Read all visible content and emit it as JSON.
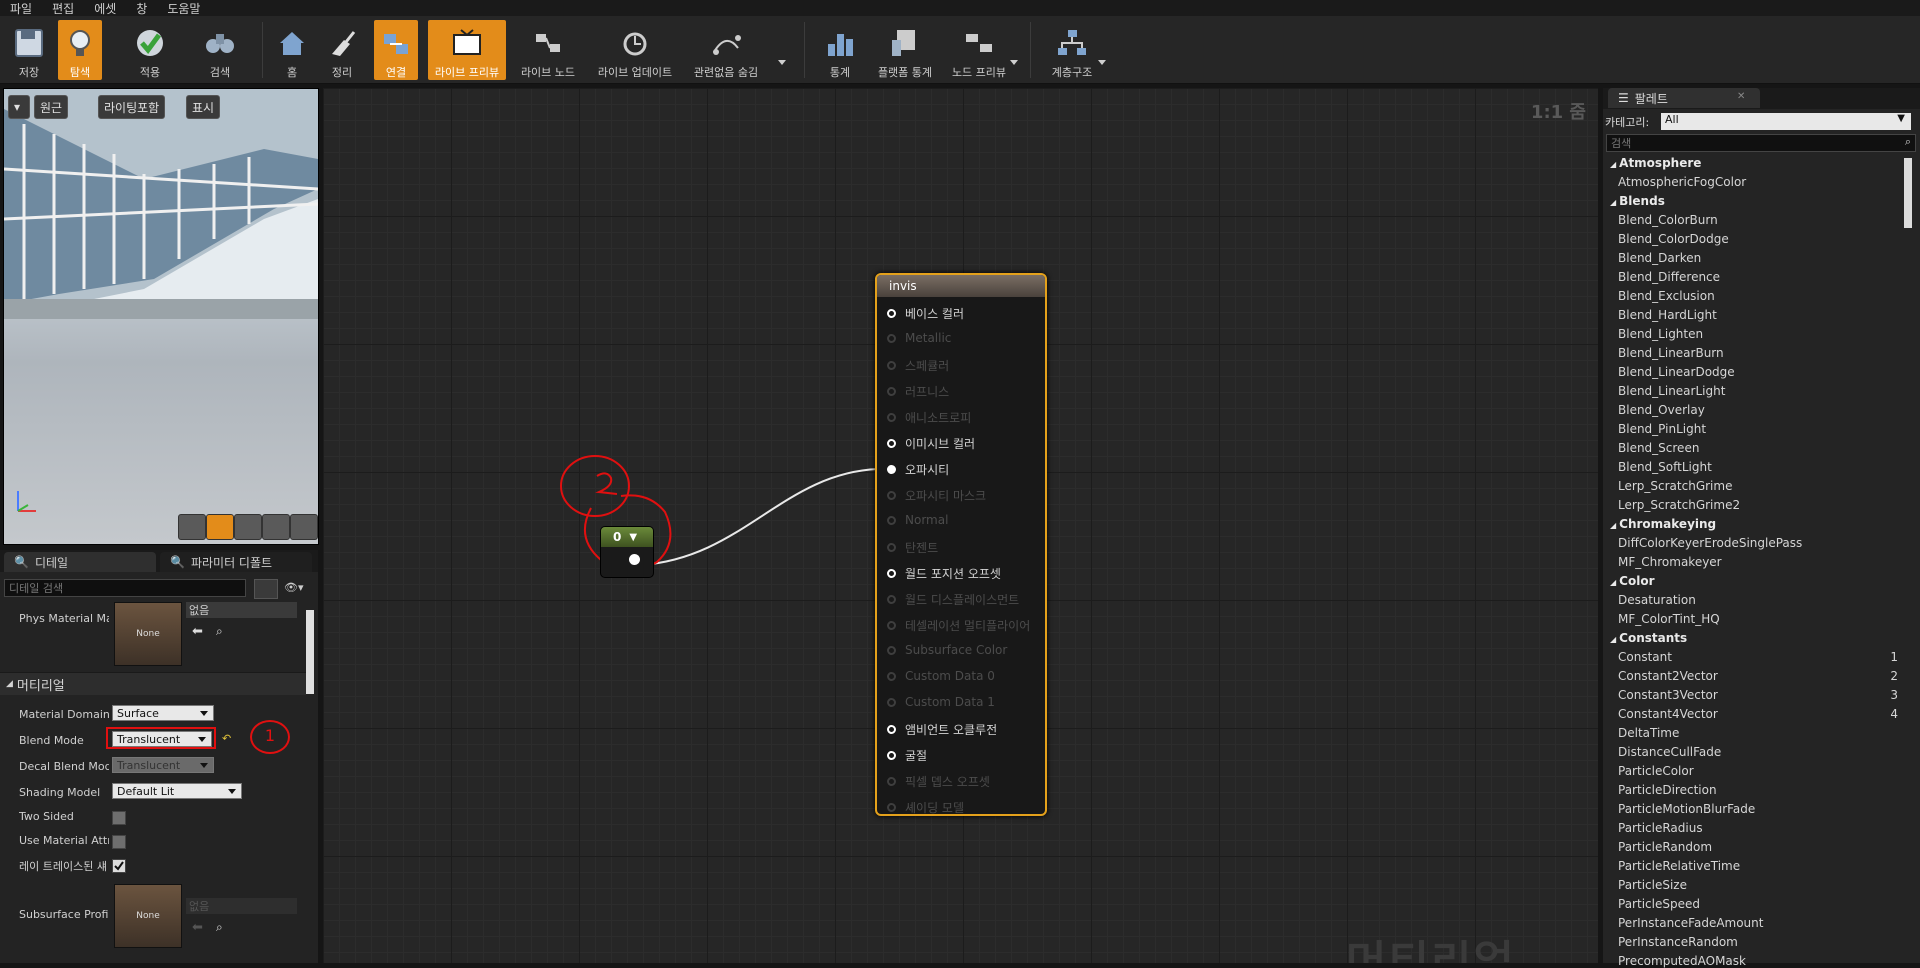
{
  "menu": [
    "파일",
    "편집",
    "에셋",
    "창",
    "도움말"
  ],
  "toolbar": {
    "save": "저장",
    "browse": "탐색",
    "apply": "적용",
    "search": "검색",
    "home": "홈",
    "cleanup": "정리",
    "connectors": "연결",
    "live_preview": "라이브 프리뷰",
    "live_nodes": "라이브 노드",
    "live_update": "라이브 업데이트",
    "hide_unrelated": "관련없음 숨김",
    "stats": "통계",
    "platform_stats": "플랫폼 통계",
    "node_preview": "노드 프리뷰",
    "hierarchy": "계층구조"
  },
  "viewport": {
    "perspective": "원근",
    "lit": "라이팅포함",
    "show": "표시"
  },
  "details": {
    "tab_details": "디테일",
    "tab_params": "파라미터 디폴트",
    "search_placeholder": "디테일 검색",
    "phys_material_label": "Phys Material Ma",
    "none": "None",
    "none_kr": "없음",
    "section_material": "머티리얼",
    "rows": [
      {
        "label": "Material Domain",
        "value": "Surface"
      },
      {
        "label": "Blend Mode",
        "value": "Translucent"
      },
      {
        "label": "Decal Blend Mode",
        "value": "Translucent"
      },
      {
        "label": "Shading Model",
        "value": "Default Lit"
      },
      {
        "label": "Two Sided"
      },
      {
        "label": "Use Material Attri"
      },
      {
        "label": "레이 트레이스된 섀"
      },
      {
        "label": "Subsurface Profil"
      }
    ],
    "annotation_1": "1"
  },
  "graph": {
    "zoom": "1:1 줌",
    "watermark": "머티리얼",
    "annotation_2": "2",
    "const_node_value": "0",
    "node_title": "invis",
    "pins": [
      {
        "label": "베이스 컬러",
        "active": true
      },
      {
        "label": "Metallic",
        "active": false
      },
      {
        "label": "스페큘러",
        "active": false
      },
      {
        "label": "러프니스",
        "active": false
      },
      {
        "label": "애니소트로피",
        "active": false
      },
      {
        "label": "이미시브 컬러",
        "active": true
      },
      {
        "label": "오파시티",
        "active": true
      },
      {
        "label": "오파시티 마스크",
        "active": false
      },
      {
        "label": "Normal",
        "active": false
      },
      {
        "label": "탄젠트",
        "active": false
      },
      {
        "label": "월드 포지션 오프셋",
        "active": true
      },
      {
        "label": "월드 디스플레이스먼트",
        "active": false
      },
      {
        "label": "테셀레이션 멀티플라이어",
        "active": false
      },
      {
        "label": "Subsurface Color",
        "active": false
      },
      {
        "label": "Custom Data 0",
        "active": false
      },
      {
        "label": "Custom Data 1",
        "active": false
      },
      {
        "label": "앰비언트 오클루전",
        "active": true
      },
      {
        "label": "굴절",
        "active": true
      },
      {
        "label": "픽셀 뎁스 오프셋",
        "active": false
      },
      {
        "label": "셰이딩 모델",
        "active": false
      }
    ]
  },
  "palette": {
    "tab": "팔레트",
    "category_label": "카테고리:",
    "category_value": "All",
    "search_placeholder": "검색",
    "items": [
      {
        "type": "cat",
        "text": "Atmosphere"
      },
      {
        "type": "item",
        "text": "AtmosphericFogColor"
      },
      {
        "type": "cat",
        "text": "Blends"
      },
      {
        "type": "item",
        "text": "Blend_ColorBurn"
      },
      {
        "type": "item",
        "text": "Blend_ColorDodge"
      },
      {
        "type": "item",
        "text": "Blend_Darken"
      },
      {
        "type": "item",
        "text": "Blend_Difference"
      },
      {
        "type": "item",
        "text": "Blend_Exclusion"
      },
      {
        "type": "item",
        "text": "Blend_HardLight"
      },
      {
        "type": "item",
        "text": "Blend_Lighten"
      },
      {
        "type": "item",
        "text": "Blend_LinearBurn"
      },
      {
        "type": "item",
        "text": "Blend_LinearDodge"
      },
      {
        "type": "item",
        "text": "Blend_LinearLight"
      },
      {
        "type": "item",
        "text": "Blend_Overlay"
      },
      {
        "type": "item",
        "text": "Blend_PinLight"
      },
      {
        "type": "item",
        "text": "Blend_Screen"
      },
      {
        "type": "item",
        "text": "Blend_SoftLight"
      },
      {
        "type": "item",
        "text": "Lerp_ScratchGrime"
      },
      {
        "type": "item",
        "text": "Lerp_ScratchGrime2"
      },
      {
        "type": "cat",
        "text": "Chromakeying"
      },
      {
        "type": "item",
        "text": "DiffColorKeyerErodeSinglePass"
      },
      {
        "type": "item",
        "text": "MF_Chromakeyer"
      },
      {
        "type": "cat",
        "text": "Color"
      },
      {
        "type": "item",
        "text": "Desaturation"
      },
      {
        "type": "item",
        "text": "MF_ColorTint_HQ"
      },
      {
        "type": "cat",
        "text": "Constants"
      },
      {
        "type": "item",
        "text": "Constant",
        "num": "1"
      },
      {
        "type": "item",
        "text": "Constant2Vector",
        "num": "2"
      },
      {
        "type": "item",
        "text": "Constant3Vector",
        "num": "3"
      },
      {
        "type": "item",
        "text": "Constant4Vector",
        "num": "4"
      },
      {
        "type": "item",
        "text": "DeltaTime"
      },
      {
        "type": "item",
        "text": "DistanceCullFade"
      },
      {
        "type": "item",
        "text": "ParticleColor"
      },
      {
        "type": "item",
        "text": "ParticleDirection"
      },
      {
        "type": "item",
        "text": "ParticleMotionBlurFade"
      },
      {
        "type": "item",
        "text": "ParticleRadius"
      },
      {
        "type": "item",
        "text": "ParticleRandom"
      },
      {
        "type": "item",
        "text": "ParticleRelativeTime"
      },
      {
        "type": "item",
        "text": "ParticleSize"
      },
      {
        "type": "item",
        "text": "ParticleSpeed"
      },
      {
        "type": "item",
        "text": "PerInstanceFadeAmount"
      },
      {
        "type": "item",
        "text": "PerInstanceRandom"
      },
      {
        "type": "item",
        "text": "PrecomputedAOMask"
      }
    ]
  },
  "colors": {
    "accent": "#e38c1a",
    "node_border": "#e4a11b",
    "annotation": "#e01010"
  }
}
